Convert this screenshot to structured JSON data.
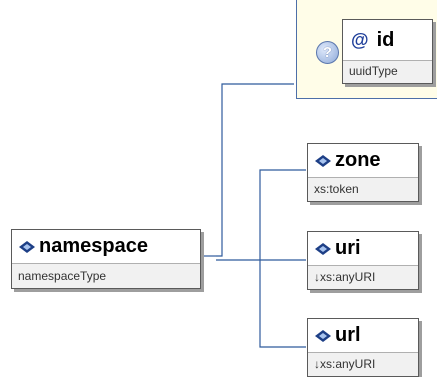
{
  "root": {
    "name": "namespace",
    "type": "namespaceType"
  },
  "attributes": [
    {
      "name": "id",
      "type": "uuidType",
      "prefix": "@"
    }
  ],
  "help_glyph": "?",
  "children": [
    {
      "name": "zone",
      "type": "xs:token"
    },
    {
      "name": "uri",
      "type": "↓xs:anyURI"
    },
    {
      "name": "url",
      "type": "↓xs:anyURI"
    }
  ],
  "colors": {
    "connector": "#2f5b9c",
    "diamond_dark": "#1d3f86",
    "diamond_light": "#a8c4ef",
    "attr_bg": "#fffde8"
  }
}
